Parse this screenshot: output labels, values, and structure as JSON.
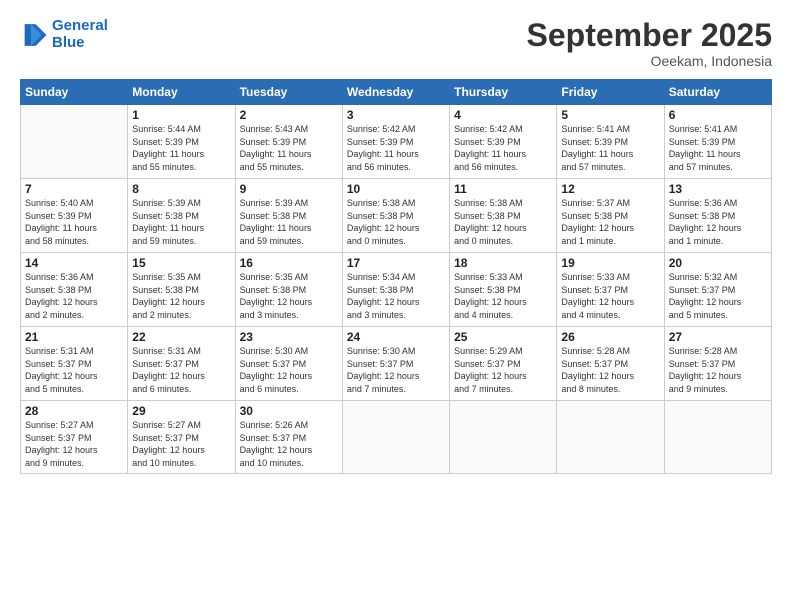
{
  "logo": {
    "line1": "General",
    "line2": "Blue"
  },
  "header": {
    "month": "September 2025",
    "location": "Oeekam, Indonesia"
  },
  "days": [
    "Sunday",
    "Monday",
    "Tuesday",
    "Wednesday",
    "Thursday",
    "Friday",
    "Saturday"
  ],
  "weeks": [
    [
      {
        "day": "",
        "content": ""
      },
      {
        "day": "1",
        "content": "Sunrise: 5:44 AM\nSunset: 5:39 PM\nDaylight: 11 hours\nand 55 minutes."
      },
      {
        "day": "2",
        "content": "Sunrise: 5:43 AM\nSunset: 5:39 PM\nDaylight: 11 hours\nand 55 minutes."
      },
      {
        "day": "3",
        "content": "Sunrise: 5:42 AM\nSunset: 5:39 PM\nDaylight: 11 hours\nand 56 minutes."
      },
      {
        "day": "4",
        "content": "Sunrise: 5:42 AM\nSunset: 5:39 PM\nDaylight: 11 hours\nand 56 minutes."
      },
      {
        "day": "5",
        "content": "Sunrise: 5:41 AM\nSunset: 5:39 PM\nDaylight: 11 hours\nand 57 minutes."
      },
      {
        "day": "6",
        "content": "Sunrise: 5:41 AM\nSunset: 5:39 PM\nDaylight: 11 hours\nand 57 minutes."
      }
    ],
    [
      {
        "day": "7",
        "content": "Sunrise: 5:40 AM\nSunset: 5:39 PM\nDaylight: 11 hours\nand 58 minutes."
      },
      {
        "day": "8",
        "content": "Sunrise: 5:39 AM\nSunset: 5:38 PM\nDaylight: 11 hours\nand 59 minutes."
      },
      {
        "day": "9",
        "content": "Sunrise: 5:39 AM\nSunset: 5:38 PM\nDaylight: 11 hours\nand 59 minutes."
      },
      {
        "day": "10",
        "content": "Sunrise: 5:38 AM\nSunset: 5:38 PM\nDaylight: 12 hours\nand 0 minutes."
      },
      {
        "day": "11",
        "content": "Sunrise: 5:38 AM\nSunset: 5:38 PM\nDaylight: 12 hours\nand 0 minutes."
      },
      {
        "day": "12",
        "content": "Sunrise: 5:37 AM\nSunset: 5:38 PM\nDaylight: 12 hours\nand 1 minute."
      },
      {
        "day": "13",
        "content": "Sunrise: 5:36 AM\nSunset: 5:38 PM\nDaylight: 12 hours\nand 1 minute."
      }
    ],
    [
      {
        "day": "14",
        "content": "Sunrise: 5:36 AM\nSunset: 5:38 PM\nDaylight: 12 hours\nand 2 minutes."
      },
      {
        "day": "15",
        "content": "Sunrise: 5:35 AM\nSunset: 5:38 PM\nDaylight: 12 hours\nand 2 minutes."
      },
      {
        "day": "16",
        "content": "Sunrise: 5:35 AM\nSunset: 5:38 PM\nDaylight: 12 hours\nand 3 minutes."
      },
      {
        "day": "17",
        "content": "Sunrise: 5:34 AM\nSunset: 5:38 PM\nDaylight: 12 hours\nand 3 minutes."
      },
      {
        "day": "18",
        "content": "Sunrise: 5:33 AM\nSunset: 5:38 PM\nDaylight: 12 hours\nand 4 minutes."
      },
      {
        "day": "19",
        "content": "Sunrise: 5:33 AM\nSunset: 5:37 PM\nDaylight: 12 hours\nand 4 minutes."
      },
      {
        "day": "20",
        "content": "Sunrise: 5:32 AM\nSunset: 5:37 PM\nDaylight: 12 hours\nand 5 minutes."
      }
    ],
    [
      {
        "day": "21",
        "content": "Sunrise: 5:31 AM\nSunset: 5:37 PM\nDaylight: 12 hours\nand 5 minutes."
      },
      {
        "day": "22",
        "content": "Sunrise: 5:31 AM\nSunset: 5:37 PM\nDaylight: 12 hours\nand 6 minutes."
      },
      {
        "day": "23",
        "content": "Sunrise: 5:30 AM\nSunset: 5:37 PM\nDaylight: 12 hours\nand 6 minutes."
      },
      {
        "day": "24",
        "content": "Sunrise: 5:30 AM\nSunset: 5:37 PM\nDaylight: 12 hours\nand 7 minutes."
      },
      {
        "day": "25",
        "content": "Sunrise: 5:29 AM\nSunset: 5:37 PM\nDaylight: 12 hours\nand 7 minutes."
      },
      {
        "day": "26",
        "content": "Sunrise: 5:28 AM\nSunset: 5:37 PM\nDaylight: 12 hours\nand 8 minutes."
      },
      {
        "day": "27",
        "content": "Sunrise: 5:28 AM\nSunset: 5:37 PM\nDaylight: 12 hours\nand 9 minutes."
      }
    ],
    [
      {
        "day": "28",
        "content": "Sunrise: 5:27 AM\nSunset: 5:37 PM\nDaylight: 12 hours\nand 9 minutes."
      },
      {
        "day": "29",
        "content": "Sunrise: 5:27 AM\nSunset: 5:37 PM\nDaylight: 12 hours\nand 10 minutes."
      },
      {
        "day": "30",
        "content": "Sunrise: 5:26 AM\nSunset: 5:37 PM\nDaylight: 12 hours\nand 10 minutes."
      },
      {
        "day": "",
        "content": ""
      },
      {
        "day": "",
        "content": ""
      },
      {
        "day": "",
        "content": ""
      },
      {
        "day": "",
        "content": ""
      }
    ]
  ]
}
